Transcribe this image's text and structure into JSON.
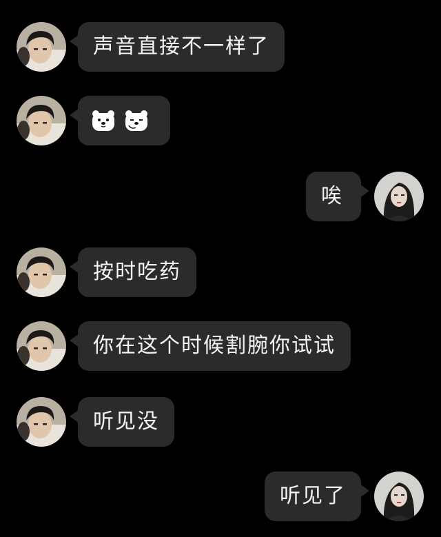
{
  "chat": {
    "messages": [
      {
        "side": "in",
        "text": "声音直接不一样了"
      },
      {
        "side": "in",
        "text": "",
        "sticker": "polar-bear-emoji-pair"
      },
      {
        "side": "out",
        "text": "唉"
      },
      {
        "side": "in",
        "text": "按时吃药"
      },
      {
        "side": "in",
        "text": "你在这个时候割腕你试试"
      },
      {
        "side": "in",
        "text": "听见没"
      },
      {
        "side": "out",
        "text": "听见了"
      }
    ]
  },
  "colors": {
    "background": "#000000",
    "bubble": "#2b2b2b",
    "text": "#f4f4f4"
  }
}
